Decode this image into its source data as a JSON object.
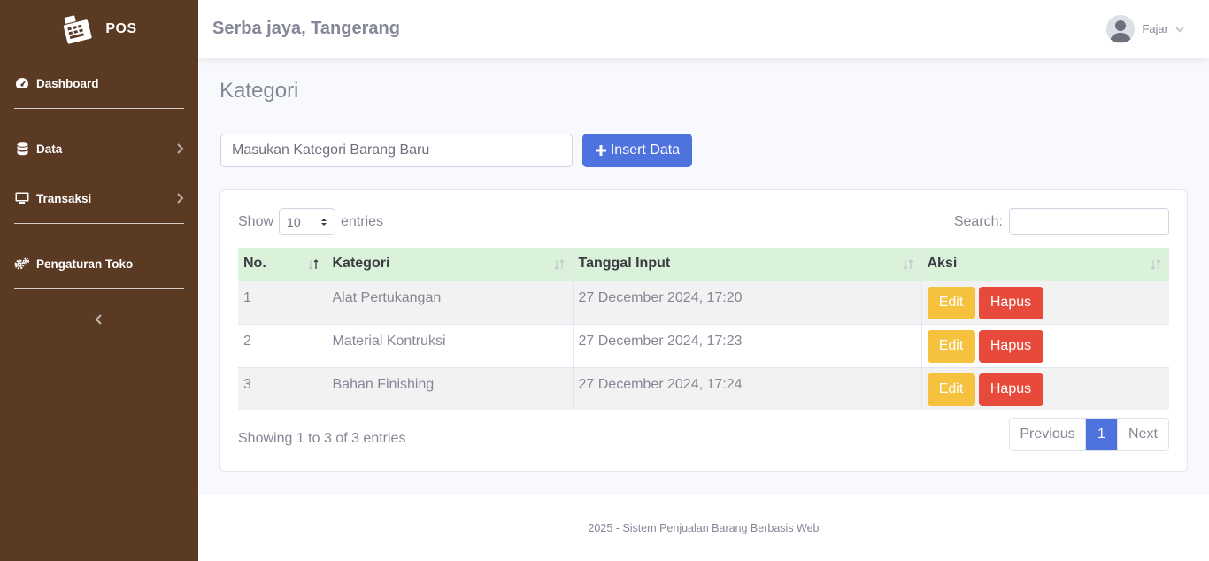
{
  "sidebar": {
    "brand": "POS",
    "items": [
      {
        "label": "Dashboard"
      },
      {
        "label": "Data"
      },
      {
        "label": "Transaksi"
      },
      {
        "label": "Pengaturan Toko"
      }
    ]
  },
  "topbar": {
    "store_name": "Serba jaya, Tangerang",
    "user_name": "Fajar"
  },
  "main": {
    "title": "Kategori",
    "input_placeholder": "Masukan Kategori Barang Baru",
    "insert_label": "Insert Data",
    "show_label": "Show",
    "entries_label": "entries",
    "page_length": "10",
    "search_label": "Search:",
    "columns": [
      "No.",
      "Kategori",
      "Tanggal Input",
      "Aksi"
    ],
    "rows": [
      {
        "no": "1",
        "kategori": "Alat Pertukangan",
        "tanggal": "27 December 2024, 17:20"
      },
      {
        "no": "2",
        "kategori": "Material Kontruksi",
        "tanggal": "27 December 2024, 17:23"
      },
      {
        "no": "3",
        "kategori": "Bahan Finishing",
        "tanggal": "27 December 2024, 17:24"
      }
    ],
    "edit_label": "Edit",
    "delete_label": "Hapus",
    "info": "Showing 1 to 3 of 3 entries",
    "pagination": {
      "previous": "Previous",
      "current": "1",
      "next": "Next"
    }
  },
  "footer": {
    "text": "2025 - Sistem Penjualan Barang Berbasis Web"
  },
  "colors": {
    "sidebar": "#5b3a24",
    "primary": "#4e73df",
    "warning": "#f6c23e",
    "danger": "#e74a3b",
    "table_header": "#d9f2d9"
  }
}
